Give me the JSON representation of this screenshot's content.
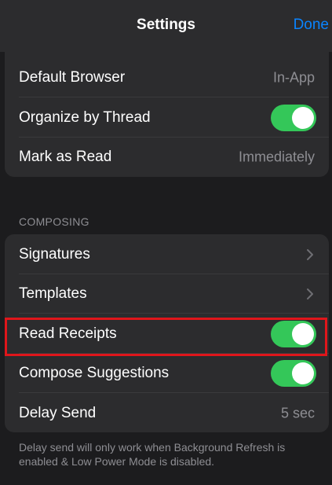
{
  "nav": {
    "title": "Settings",
    "done_label": "Done"
  },
  "general": {
    "default_browser": {
      "label": "Default Browser",
      "value": "In-App"
    },
    "organize_by_thread": {
      "label": "Organize by Thread",
      "enabled": true
    },
    "mark_as_read": {
      "label": "Mark as Read",
      "value": "Immediately"
    }
  },
  "composing": {
    "header": "COMPOSING",
    "signatures": {
      "label": "Signatures"
    },
    "templates": {
      "label": "Templates"
    },
    "read_receipts": {
      "label": "Read Receipts",
      "enabled": true
    },
    "compose_suggestions": {
      "label": "Compose Suggestions",
      "enabled": true
    },
    "delay_send": {
      "label": "Delay Send",
      "value": "5 sec"
    },
    "footer": "Delay send will only work when Background Refresh is enabled & Low Power Mode is disabled."
  },
  "colors": {
    "accent": "#0a84ff",
    "toggle_on": "#34c759",
    "highlight": "#e0161b",
    "background": "#1c1c1e",
    "cell": "#2c2c2e"
  },
  "icons": [
    "chevron-right-icon"
  ]
}
